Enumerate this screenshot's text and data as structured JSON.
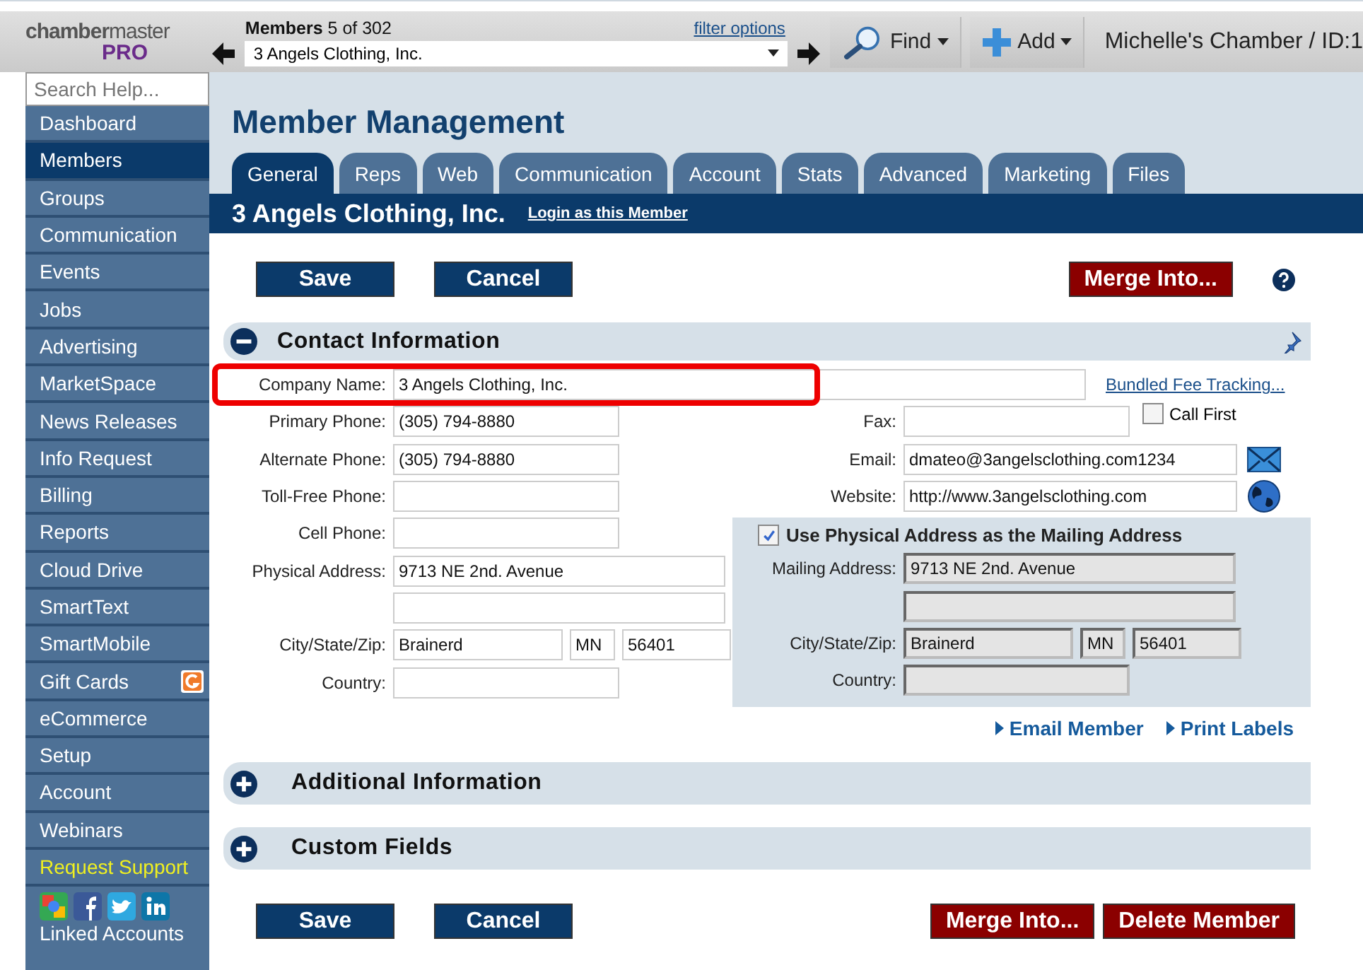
{
  "logo": {
    "text": "**chamber**master",
    "edition": "PRO"
  },
  "record_nav": {
    "label": "Members",
    "position": "5 of 302",
    "filter_link": "filter options",
    "value": "3 Angels Clothing, Inc."
  },
  "toolbar": [
    {
      "kind": "find",
      "label": "Find"
    },
    {
      "kind": "add",
      "label": "Add"
    }
  ],
  "account": "Michelle's Chamber / ID:1",
  "sidebar": {
    "search_placeholder": "Search Help...",
    "items": [
      {
        "label": "Dashboard",
        "selected": false,
        "kind": "plain"
      },
      {
        "label": "Members",
        "selected": true,
        "kind": "plain"
      },
      {
        "label": "Groups",
        "selected": false,
        "kind": "plain"
      },
      {
        "label": "Communication",
        "selected": false,
        "kind": "plain"
      },
      {
        "label": "Events",
        "selected": false,
        "kind": "plain"
      },
      {
        "label": "Jobs",
        "selected": false,
        "kind": "plain"
      },
      {
        "label": "Advertising",
        "selected": false,
        "kind": "plain"
      },
      {
        "label": "MarketSpace",
        "selected": false,
        "kind": "plain"
      },
      {
        "label": "News Releases",
        "selected": false,
        "kind": "plain"
      },
      {
        "label": "Info Request",
        "selected": false,
        "kind": "plain"
      },
      {
        "label": "Billing",
        "selected": false,
        "kind": "plain"
      },
      {
        "label": "Reports",
        "selected": false,
        "kind": "plain"
      },
      {
        "label": "Cloud Drive",
        "selected": false,
        "kind": "plain"
      },
      {
        "label": "SmartText",
        "selected": false,
        "kind": "plain"
      },
      {
        "label": "SmartMobile",
        "selected": false,
        "kind": "plain"
      },
      {
        "label": "Gift Cards",
        "selected": false,
        "kind": "badged"
      },
      {
        "label": "eCommerce",
        "selected": false,
        "kind": "plain"
      },
      {
        "label": "Setup",
        "selected": false,
        "kind": "plain"
      },
      {
        "label": "Account",
        "selected": false,
        "kind": "plain"
      },
      {
        "label": "Webinars",
        "selected": false,
        "kind": "plain"
      },
      {
        "label": "Request Support",
        "selected": false,
        "kind": "support"
      }
    ],
    "linked_accounts": "Linked Accounts"
  },
  "page_title": "Member Management",
  "tabs": [
    {
      "label": "General",
      "selected": true
    },
    {
      "label": "Reps",
      "selected": false
    },
    {
      "label": "Web",
      "selected": false
    },
    {
      "label": "Communication",
      "selected": false
    },
    {
      "label": "Account",
      "selected": false
    },
    {
      "label": "Stats",
      "selected": false
    },
    {
      "label": "Advanced",
      "selected": false
    },
    {
      "label": "Marketing",
      "selected": false
    },
    {
      "label": "Files",
      "selected": false
    }
  ],
  "member": {
    "name": "3 Angels Clothing, Inc.",
    "login_link": "Login as this Member"
  },
  "top_buttons": [
    {
      "kind": "primary",
      "label": "Save"
    },
    {
      "kind": "primary",
      "label": "Cancel"
    },
    {
      "kind": "danger",
      "label": "Merge Into..."
    }
  ],
  "contact": {
    "title": "Contact Information",
    "expanded": true,
    "company": {
      "label": "Company Name:",
      "value": "3 Angels Clothing, Inc.",
      "highlighted": true
    },
    "bundled_link": "Bundled Fee Tracking...",
    "left_fields": [
      {
        "kind": "phone",
        "label": "Primary Phone:",
        "value": "(305) 794-8880"
      },
      {
        "kind": "phone",
        "label": "Alternate Phone:",
        "value": "(305) 794-8880"
      },
      {
        "kind": "phone",
        "label": "Toll-Free Phone:"
      },
      {
        "kind": "phone",
        "label": "Cell Phone:"
      },
      {
        "kind": "address",
        "label": "Physical Address:",
        "value": "9713 NE 2nd. Avenue"
      },
      {
        "kind": "address"
      },
      {
        "kind": "city_state_zip",
        "label": "City/State/Zip:",
        "city": "Brainerd",
        "state": "MN",
        "zip": "56401"
      },
      {
        "kind": "country",
        "label": "Country:"
      }
    ],
    "right_fields": [
      {
        "kind": "fax",
        "label": "Fax:",
        "check_label": "Call First",
        "checked": false
      },
      {
        "kind": "email",
        "label": "Email:",
        "value": "dmateo@3angelsclothing.com1234"
      },
      {
        "kind": "website",
        "label": "Website:",
        "value": "http://www.3angelsclothing.com"
      }
    ],
    "mailing": {
      "use_physical": true,
      "check_label": "Use Physical Address as the Mailing Address",
      "fields": [
        {
          "kind": "address",
          "label": "Mailing Address:",
          "value": "9713 NE 2nd. Avenue"
        },
        {
          "kind": "address"
        },
        {
          "kind": "city_state_zip",
          "label": "City/State/Zip:",
          "city": "Brainerd",
          "state": "MN",
          "zip": "56401"
        },
        {
          "kind": "country",
          "label": "Country:"
        }
      ]
    }
  },
  "contact_links": [
    "Email Member",
    "Print Labels"
  ],
  "sections": [
    {
      "title": "Additional Information",
      "expanded": false
    },
    {
      "title": "Custom Fields",
      "expanded": false
    }
  ],
  "bottom_buttons": [
    {
      "kind": "primary",
      "label": "Save"
    },
    {
      "kind": "primary",
      "label": "Cancel"
    },
    {
      "kind": "danger",
      "label": "Merge Into..."
    },
    {
      "kind": "danger",
      "label": "Delete Member"
    }
  ]
}
